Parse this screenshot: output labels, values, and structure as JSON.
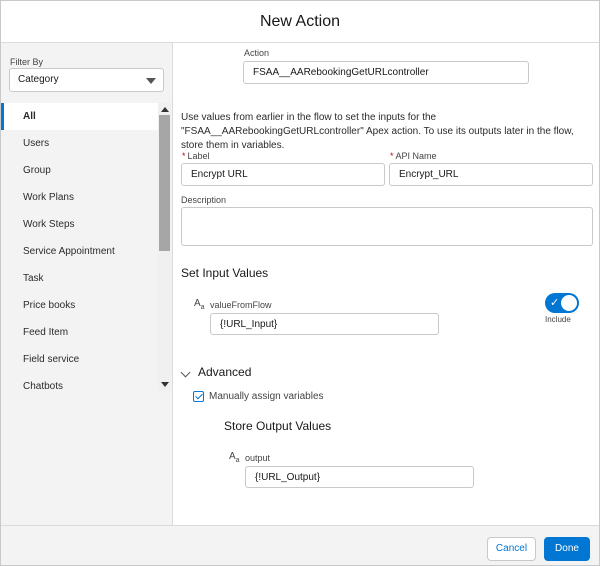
{
  "dialog": {
    "title": "New Action"
  },
  "sidebar": {
    "filter_label": "Filter By",
    "filter_value": "Category",
    "items": [
      {
        "label": "All"
      },
      {
        "label": "Users"
      },
      {
        "label": "Group"
      },
      {
        "label": "Work Plans"
      },
      {
        "label": "Work Steps"
      },
      {
        "label": "Service Appointment"
      },
      {
        "label": "Task"
      },
      {
        "label": "Price books"
      },
      {
        "label": "Feed Item"
      },
      {
        "label": "Field service"
      },
      {
        "label": "Chatbots"
      }
    ],
    "active_index": 0
  },
  "main": {
    "action_label": "Action",
    "action_value": "FSAA__AARebookingGetURLcontroller",
    "description_text": "Use values from earlier in the flow to set the inputs for the \"FSAA__AARebookingGetURLcontroller\" Apex action. To use its outputs later in the flow, store them in variables.",
    "required_marker": "*",
    "label_label": "Label",
    "label_value": "Encrypt URL",
    "api_name_label": "API Name",
    "api_name_value": "Encrypt_URL",
    "description_label": "Description",
    "description_value": "",
    "set_input_heading": "Set Input Values",
    "type_icon_a": "A",
    "type_icon_sub": "a",
    "input_param_label": "valueFromFlow",
    "input_param_value": "{!URL_Input}",
    "include_label": "Include",
    "include_on": true,
    "advanced_heading": "Advanced",
    "manual_assign_label": "Manually assign variables",
    "manual_assign_checked": true,
    "store_output_heading": "Store Output Values",
    "output_param_label": "output",
    "output_param_value": "{!URL_Output}"
  },
  "footer": {
    "cancel_label": "Cancel",
    "done_label": "Done"
  },
  "colors": {
    "brand": "#0176d3",
    "required": "#ba0517",
    "sidebar_bg": "#f3f3f3"
  }
}
